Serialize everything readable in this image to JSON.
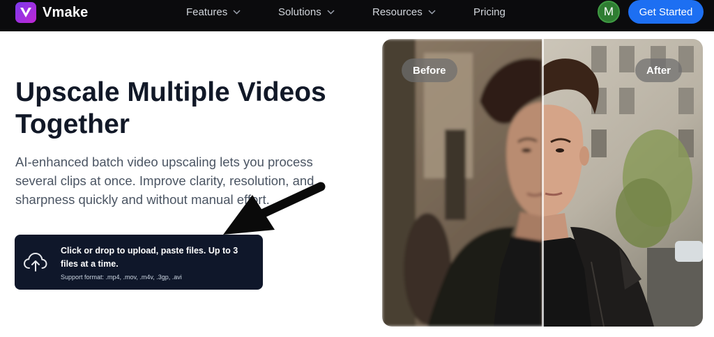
{
  "nav": {
    "brand": "Vmake",
    "items": [
      {
        "label": "Features",
        "has_dropdown": true
      },
      {
        "label": "Solutions",
        "has_dropdown": true
      },
      {
        "label": "Resources",
        "has_dropdown": true
      },
      {
        "label": "Pricing",
        "has_dropdown": false
      }
    ],
    "avatar_initial": "M",
    "cta_label": "Get Started"
  },
  "hero": {
    "title": "Upscale Multiple Videos Together",
    "description": "AI-enhanced batch video upscaling lets you process several clips at once. Improve clarity, resolution, and sharpness quickly and without manual effort.",
    "upload": {
      "title": "Click or drop to upload, paste files. Up to 3 files at a time.",
      "formats": "Support format: .mp4, .mov, .m4v, .3gp, .avi",
      "icon": "cloud-upload-icon"
    }
  },
  "comparison": {
    "before_label": "Before",
    "after_label": "After"
  },
  "colors": {
    "nav_bg": "#0b0b0d",
    "cta": "#1d6ff2",
    "avatar": "#2f7d32",
    "upload_bg": "#0f172a",
    "brand_gradient": [
      "#7c3aed",
      "#c026d3"
    ]
  }
}
